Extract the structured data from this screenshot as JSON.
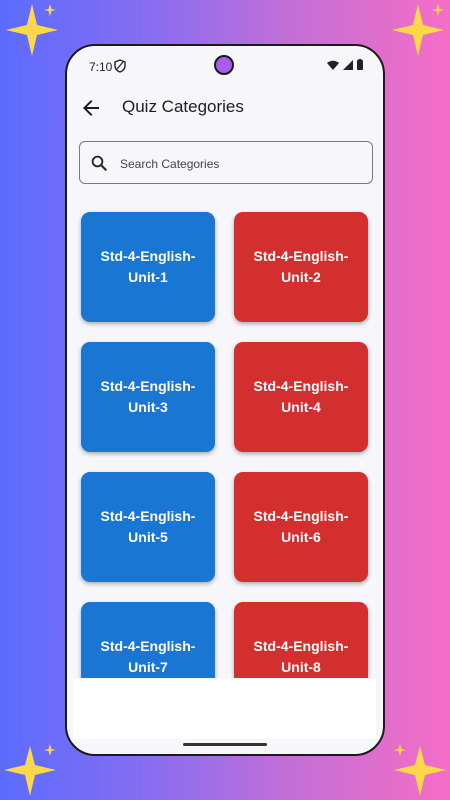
{
  "status_bar": {
    "time": "7:10"
  },
  "app_bar": {
    "title": "Quiz Categories"
  },
  "search": {
    "placeholder": "Search Categories",
    "value": ""
  },
  "categories": [
    {
      "label": "Std-4-English-Unit-1",
      "color": "#1976d2"
    },
    {
      "label": "Std-4-English-Unit-2",
      "color": "#d32f2f"
    },
    {
      "label": "Std-4-English-Unit-3",
      "color": "#1976d2"
    },
    {
      "label": "Std-4-English-Unit-4",
      "color": "#d32f2f"
    },
    {
      "label": "Std-4-English-Unit-5",
      "color": "#1976d2"
    },
    {
      "label": "Std-4-English-Unit-6",
      "color": "#d32f2f"
    },
    {
      "label": "Std-4-English-Unit-7",
      "color": "#1976d2"
    },
    {
      "label": "Std-4-English-Unit-8",
      "color": "#d32f2f"
    }
  ],
  "icons": {
    "back": "arrow-left-icon",
    "search": "search-icon",
    "wifi": "wifi-icon",
    "signal": "signal-icon",
    "battery": "battery-icon",
    "shield": "shield-icon"
  }
}
